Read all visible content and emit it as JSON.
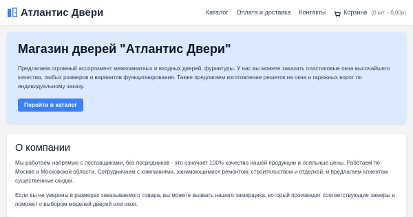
{
  "header": {
    "brand": "Атлантис Двери",
    "brand_icon": "door-icon",
    "nav": {
      "catalog": "Каталог",
      "payment_delivery": "Оплата и доставка",
      "contacts": "Контакты",
      "cart_label": "Корзина",
      "cart_count": "(0 шт. - 0,00р)",
      "cart_icon": "cart-icon"
    }
  },
  "hero": {
    "title": "Магазин дверей \"Атлантис Двери\"",
    "text": "Предлагаем огромный ассортимент межкомнатных и входных дверей, фурнитуры. У нас вы можете заказать пластиковые окна высочайшего качества, любых размеров и вариантов функционирования. Также предлагаем изготовление решеток на окна и гаражных ворот по индивидуальному заказу.",
    "button": "Перейти в каталог"
  },
  "about": {
    "title": "О компании",
    "paragraphs": [
      "Мы работаем напрямую с поставщиками, без посредников - это означает 100% качество нашей продукции и лояльные цены. Работаем по Москве и Московской области. Сотрудничаем с компаниями, занимающимися ремонтом, строительством и отделкой, и предлагаем клиентам существенные скидки.",
      "Если вы не уверены в размерах заказываемого товара, вы можете вызвать нашего замерщика, который произведет соответствующие замеры и поможет с выбором моделей дверей или окон."
    ]
  },
  "colors": {
    "accent": "#3b82f6",
    "hero_bg": "#dbeafe",
    "page_bg": "#f3f4f6"
  }
}
